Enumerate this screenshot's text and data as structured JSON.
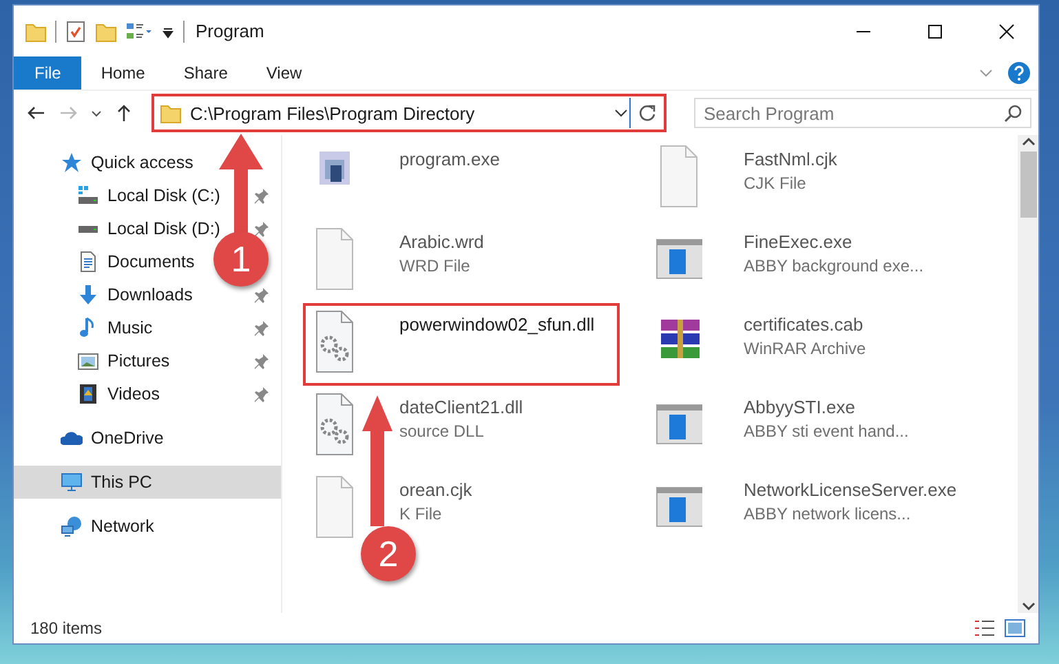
{
  "window": {
    "title": "Program"
  },
  "ribbon_tabs": [
    {
      "label": "File",
      "selected": true
    },
    {
      "label": "Home",
      "selected": false
    },
    {
      "label": "Share",
      "selected": false
    },
    {
      "label": "View",
      "selected": false
    }
  ],
  "navigation": {
    "forward_disabled": true
  },
  "address": {
    "path": "C:\\Program Files\\Program Directory",
    "marked": true
  },
  "search": {
    "placeholder": "Search Program"
  },
  "sidebar": {
    "items": [
      {
        "label": "Quick access",
        "kind": "star",
        "selected": false,
        "children": [
          {
            "label": "Local Disk (C:)",
            "kind": "windows-drive",
            "pinned": true,
            "selected": false
          },
          {
            "label": "Local Disk (D:)",
            "kind": "drive",
            "pinned": true,
            "selected": false
          },
          {
            "label": "Documents",
            "kind": "documents",
            "pinned": false,
            "selected": false
          },
          {
            "label": "Downloads",
            "kind": "download",
            "pinned": true,
            "selected": false
          },
          {
            "label": "Music",
            "kind": "music",
            "pinned": true,
            "selected": false
          },
          {
            "label": "Pictures",
            "kind": "pictures",
            "pinned": true,
            "selected": false
          },
          {
            "label": "Videos",
            "kind": "videos",
            "pinned": true,
            "selected": false
          }
        ]
      },
      {
        "label": "OneDrive",
        "kind": "cloud",
        "selected": false
      },
      {
        "label": "This PC",
        "kind": "pc",
        "selected": true
      },
      {
        "label": "Network",
        "kind": "network",
        "selected": false
      }
    ]
  },
  "files": [
    {
      "name": "program.exe",
      "kind": "setup",
      "blurred": true,
      "marked": false
    },
    {
      "name": "FastNml.cjk",
      "type": "CJK File",
      "kind": "blank",
      "blurred": true,
      "marked": false
    },
    {
      "name": "Arabic.wrd",
      "type": "WRD File",
      "kind": "blank",
      "blurred": true,
      "marked": false
    },
    {
      "name": "FineExec.exe",
      "type": "ABBY background exe...",
      "kind": "app",
      "blurred": true,
      "marked": false
    },
    {
      "name": "powerwindow02_sfun.dll",
      "kind": "dll",
      "blurred": false,
      "marked": true
    },
    {
      "name": "certificates.cab",
      "type": "WinRAR Archive",
      "kind": "archive",
      "blurred": true,
      "marked": false
    },
    {
      "name": "dateClient21.dll",
      "type": "source DLL",
      "kind": "dll",
      "blurred": true,
      "marked": false
    },
    {
      "name": "AbbyySTI.exe",
      "type": "ABBY sti event hand...",
      "kind": "app",
      "blurred": true,
      "marked": false
    },
    {
      "name": "orean.cjk",
      "type": "K File",
      "kind": "blank",
      "blurred": true,
      "marked": false
    },
    {
      "name": "NetworkLicenseServer.exe",
      "type": "ABBY network licens...",
      "kind": "app",
      "blurred": true,
      "marked": false
    }
  ],
  "status_bar": {
    "item_count": "180 items"
  },
  "annotations": [
    {
      "number": "1"
    },
    {
      "number": "2"
    }
  ]
}
